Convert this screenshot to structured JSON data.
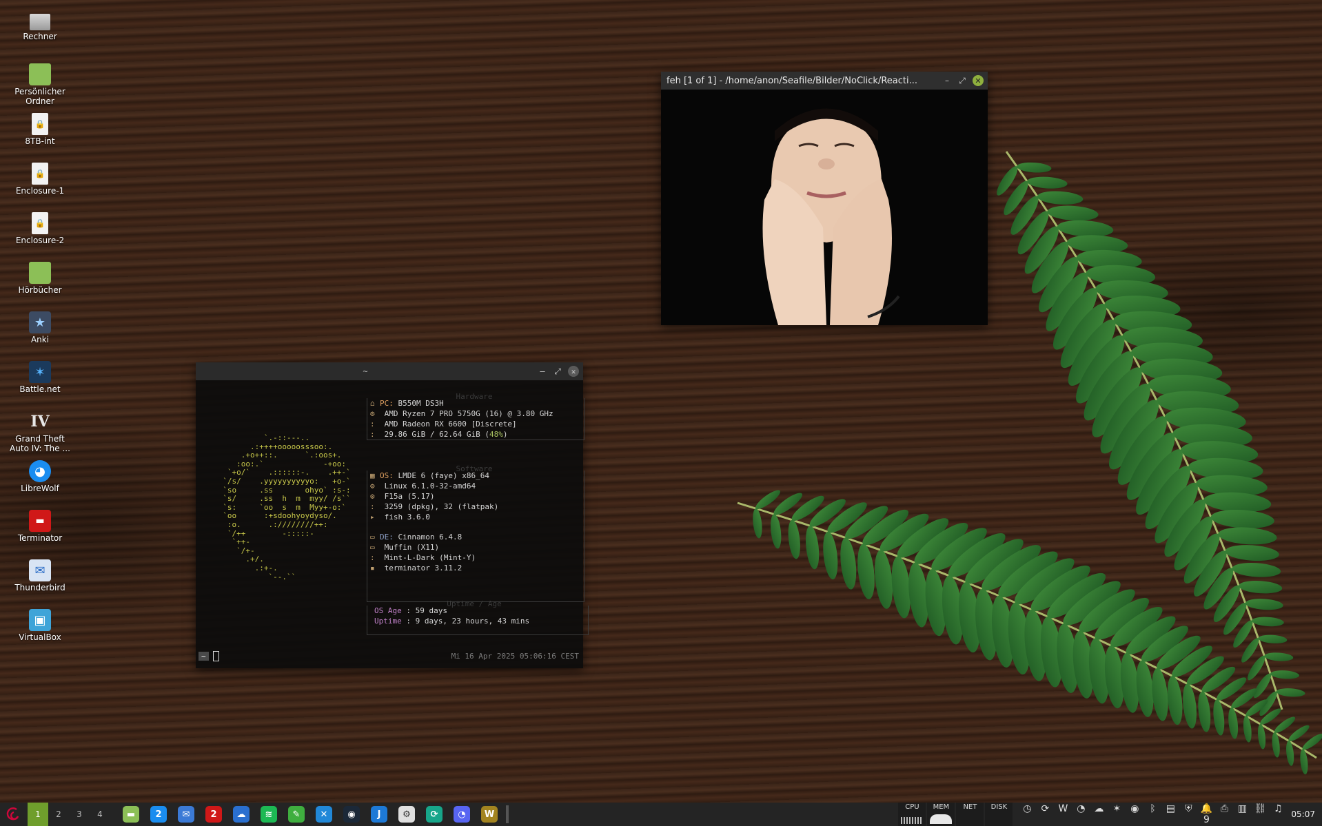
{
  "desktop": {
    "icons": [
      {
        "label": "Rechner",
        "icon": "computer-icon",
        "glyph": ""
      },
      {
        "label": "Persönlicher Ordner",
        "icon": "home-folder-icon",
        "glyph": ""
      },
      {
        "label": "8TB-int",
        "icon": "drive-icon",
        "glyph": "🔒"
      },
      {
        "label": "Enclosure-1",
        "icon": "drive-icon",
        "glyph": "🔒"
      },
      {
        "label": "Enclosure-2",
        "icon": "drive-icon",
        "glyph": "🔒"
      },
      {
        "label": "Hörbücher",
        "icon": "folder-icon",
        "glyph": ""
      },
      {
        "label": "Anki",
        "icon": "anki-icon",
        "glyph": "★"
      },
      {
        "label": "Battle.net",
        "icon": "battlenet-icon",
        "glyph": "✶"
      },
      {
        "label": "Grand Theft Auto IV: The ...",
        "icon": "gta-icon",
        "glyph": "IV"
      },
      {
        "label": "LibreWolf",
        "icon": "librewolf-icon",
        "glyph": "◕"
      },
      {
        "label": "Terminator",
        "icon": "terminator-icon",
        "glyph": "▬"
      },
      {
        "label": "Thunderbird",
        "icon": "thunderbird-icon",
        "glyph": "✉"
      },
      {
        "label": "VirtualBox",
        "icon": "virtualbox-icon",
        "glyph": "▣"
      }
    ]
  },
  "feh": {
    "title": "feh [1 of 1] - /home/anon/Seafile/Bilder/NoClick/Reacti..."
  },
  "terminal": {
    "title": "~",
    "logo": "           `.-::---..\n        .:++++ooooosssoo:.\n      .+o++::.      `.:oos+.\n     :oo:.`             -+oo:\n   `+o/`    .::::::-.    .++-`\n  `/s/    .yyyyyyyyyyo:   +o-`\n  `so     .ss       ohyo` :s-:\n  `s/     .ss  h  m  myy/ /s``\n  `s:     `oo  s  m  Myy+-o:`\n  `oo      :+sdoohyoydyso/.\n   :o.      .:////////++:\n   `/++        -:::::-\n    `++-\n     `/+-\n       .+/.\n         .:+-.\n            `--.``",
    "hardware_title": "Hardware",
    "software_title": "Software",
    "uptime_title": "Uptime / Age",
    "hw": [
      {
        "icon": "⌂",
        "key": "PC:",
        "val": " B550M DS3H"
      },
      {
        "icon": "⚙",
        "key": "",
        "val": " AMD Ryzen 7 PRO 5750G (16) @ 3.80 GHz"
      },
      {
        "icon": ":",
        "key": "",
        "val": " AMD Radeon RX 6600 [Discrete]"
      },
      {
        "icon": ":",
        "key": "",
        "val": " 29.86 GiB / 62.64 GiB (",
        "pct": "48%",
        "tail": ")"
      }
    ],
    "sw": [
      {
        "icon": "▦",
        "key": "OS:",
        "val": " LMDE 6 (faye) x86_64"
      },
      {
        "icon": "⚙",
        "key": "",
        "val": " Linux 6.1.0-32-amd64"
      },
      {
        "icon": "⚙",
        "key": "",
        "val": " F15a (5.17)"
      },
      {
        "icon": ":",
        "key": "",
        "val": " 3259 (dpkg), 32 (flatpak)"
      },
      {
        "icon": "▸",
        "key": "",
        "val": " fish 3.6.0"
      }
    ],
    "de": [
      {
        "icon": "▭",
        "key": "DE:",
        "val": " Cinnamon 6.4.8"
      },
      {
        "icon": "▭",
        "key": "",
        "val": " Muffin (X11)"
      },
      {
        "icon": ":",
        "key": "",
        "val": " Mint-L-Dark (Mint-Y)"
      },
      {
        "icon": "▪",
        "key": "",
        "val": " terminator 3.11.2"
      }
    ],
    "uptime": [
      {
        "key": "OS Age ",
        "val": ": 59 days"
      },
      {
        "key": "Uptime ",
        "val": ": 9 days, 23 hours, 43 mins"
      }
    ],
    "prompt": "~",
    "right_prompt": "Mi 16 Apr 2025 05:06:16 CEST"
  },
  "taskbar": {
    "workspaces": [
      "1",
      "2",
      "3",
      "4"
    ],
    "apps": [
      {
        "name": "files",
        "icon": "folder-icon",
        "glyph": "▬",
        "color": "#8cbf57"
      },
      {
        "name": "librewolf",
        "icon": "librewolf-icon",
        "glyph": "2",
        "color": "#1a8df0"
      },
      {
        "name": "thunderbird",
        "icon": "thunderbird-icon",
        "glyph": "✉",
        "color": "#3b7ad6"
      },
      {
        "name": "terminator",
        "icon": "terminator-icon",
        "glyph": "2",
        "color": "#d01818"
      },
      {
        "name": "seafile",
        "icon": "seafile-icon",
        "glyph": "☁",
        "color": "#2a6fcf"
      },
      {
        "name": "spotify",
        "icon": "spotify-icon",
        "glyph": "≋",
        "color": "#1db954"
      },
      {
        "name": "game-mode",
        "icon": "game-icon",
        "glyph": "✎",
        "color": "#3fae3f"
      },
      {
        "name": "xfce",
        "icon": "x-tool-icon",
        "glyph": "✕",
        "color": "#2188d8"
      },
      {
        "name": "steam",
        "icon": "steam-icon",
        "glyph": "◉",
        "color": "#1b2838"
      },
      {
        "name": "jellyfin",
        "icon": "jellyfin-icon",
        "glyph": "J",
        "color": "#1d79d6"
      },
      {
        "name": "settings",
        "icon": "gear-icon",
        "glyph": "⚙",
        "color": "#e0e0e0"
      },
      {
        "name": "nextcloud",
        "icon": "sync-icon",
        "glyph": "⟳",
        "color": "#17a68a"
      },
      {
        "name": "discord",
        "icon": "discord-icon",
        "glyph": "◔",
        "color": "#5865f2"
      },
      {
        "name": "wow",
        "icon": "wow-icon",
        "glyph": "W",
        "color": "#a38420"
      }
    ],
    "monitors": [
      "CPU",
      "MEM",
      "NET",
      "DISK"
    ],
    "tray": [
      "◷",
      "⟳",
      "W",
      "◔",
      "☁",
      "✶",
      "◉",
      "ᛒ",
      "▤",
      "⛨",
      "🔔9",
      "⎙",
      "▥",
      "⛓",
      "♫"
    ],
    "clock": "05:07"
  }
}
